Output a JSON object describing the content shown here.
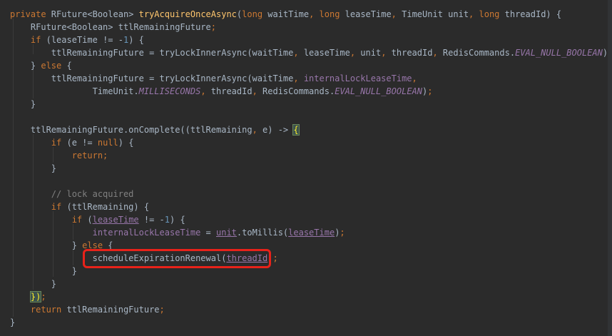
{
  "editor": {
    "lines": [
      [
        {
          "t": "private ",
          "c": "kw"
        },
        {
          "t": "RFuture<Boolean> "
        },
        {
          "t": "tryAcquireOnceAsync",
          "c": "fn"
        },
        {
          "t": "("
        },
        {
          "t": "long ",
          "c": "kw"
        },
        {
          "t": "waitTime"
        },
        {
          "t": ", ",
          "c": "kw"
        },
        {
          "t": "long ",
          "c": "kw"
        },
        {
          "t": "leaseTime"
        },
        {
          "t": ", ",
          "c": "kw"
        },
        {
          "t": "TimeUnit unit"
        },
        {
          "t": ", ",
          "c": "kw"
        },
        {
          "t": "long ",
          "c": "kw"
        },
        {
          "t": "threadId) {"
        }
      ],
      [
        {
          "t": "    RFuture<Boolean> ttlRemainingFuture"
        },
        {
          "t": ";",
          "c": "kw"
        }
      ],
      [
        {
          "t": "    "
        },
        {
          "t": "if ",
          "c": "kw"
        },
        {
          "t": "(leaseTime != -"
        },
        {
          "t": "1",
          "c": "num"
        },
        {
          "t": ") {"
        }
      ],
      [
        {
          "t": "        ttlRemainingFuture = tryLockInnerAsync(waitTime"
        },
        {
          "t": ", ",
          "c": "kw"
        },
        {
          "t": "leaseTime"
        },
        {
          "t": ", ",
          "c": "kw"
        },
        {
          "t": "unit"
        },
        {
          "t": ", ",
          "c": "kw"
        },
        {
          "t": "threadId"
        },
        {
          "t": ", ",
          "c": "kw"
        },
        {
          "t": "RedisCommands."
        },
        {
          "t": "EVAL_NULL_BOOLEAN",
          "c": "ital"
        },
        {
          "t": ")"
        },
        {
          "t": ";",
          "c": "kw"
        }
      ],
      [
        {
          "t": "    } "
        },
        {
          "t": "else ",
          "c": "kw"
        },
        {
          "t": "{"
        }
      ],
      [
        {
          "t": "        ttlRemainingFuture = tryLockInnerAsync(waitTime"
        },
        {
          "t": ", ",
          "c": "kw"
        },
        {
          "t": "internalLockLeaseTime",
          "c": "field"
        },
        {
          "t": ",",
          "c": "kw"
        }
      ],
      [
        {
          "t": "                TimeUnit."
        },
        {
          "t": "MILLISECONDS",
          "c": "ital"
        },
        {
          "t": ", ",
          "c": "kw"
        },
        {
          "t": "threadId"
        },
        {
          "t": ", ",
          "c": "kw"
        },
        {
          "t": "RedisCommands."
        },
        {
          "t": "EVAL_NULL_BOOLEAN",
          "c": "ital"
        },
        {
          "t": ")"
        },
        {
          "t": ";",
          "c": "kw"
        }
      ],
      [
        {
          "t": "    }"
        }
      ],
      [],
      [
        {
          "t": "    ttlRemainingFuture.onComplete((ttlRemaining"
        },
        {
          "t": ", ",
          "c": "kw"
        },
        {
          "t": "e) -> "
        },
        {
          "t": "{",
          "c": "brace-hl"
        }
      ],
      [
        {
          "t": "        "
        },
        {
          "t": "if ",
          "c": "kw"
        },
        {
          "t": "(e != "
        },
        {
          "t": "null",
          "c": "kw"
        },
        {
          "t": ") {"
        }
      ],
      [
        {
          "t": "            "
        },
        {
          "t": "return;",
          "c": "kw"
        }
      ],
      [
        {
          "t": "        }"
        }
      ],
      [],
      [
        {
          "t": "        "
        },
        {
          "t": "// lock acquired",
          "c": "comment"
        }
      ],
      [
        {
          "t": "        "
        },
        {
          "t": "if ",
          "c": "kw"
        },
        {
          "t": "(ttlRemaining) {"
        }
      ],
      [
        {
          "t": "            "
        },
        {
          "t": "if ",
          "c": "kw"
        },
        {
          "t": "("
        },
        {
          "t": "leaseTime",
          "c": "field ul"
        },
        {
          "t": " != -"
        },
        {
          "t": "1",
          "c": "num"
        },
        {
          "t": ") {"
        }
      ],
      [
        {
          "t": "                "
        },
        {
          "t": "internalLockLeaseTime",
          "c": "field"
        },
        {
          "t": " = "
        },
        {
          "t": "unit",
          "c": "field ul"
        },
        {
          "t": ".toMillis("
        },
        {
          "t": "leaseTime",
          "c": "field ul"
        },
        {
          "t": ")"
        },
        {
          "t": ";",
          "c": "kw"
        }
      ],
      [
        {
          "t": "            } "
        },
        {
          "t": "else ",
          "c": "kw"
        },
        {
          "t": "{"
        }
      ],
      [
        {
          "t": "                scheduleExpirationRenewal("
        },
        {
          "t": "threadId",
          "c": "field ul"
        },
        {
          "t": ")"
        },
        {
          "t": ";",
          "c": "kw"
        }
      ],
      [
        {
          "t": "            }"
        }
      ],
      [
        {
          "t": "        }"
        }
      ],
      [
        {
          "t": "    "
        },
        {
          "t": "})",
          "c": "brace-hl"
        },
        {
          "t": ";",
          "c": "kw"
        }
      ],
      [
        {
          "t": "    "
        },
        {
          "t": "return ",
          "c": "kw"
        },
        {
          "t": "ttlRemainingFuture"
        },
        {
          "t": ";",
          "c": "kw"
        }
      ],
      [
        {
          "t": "}"
        }
      ]
    ]
  },
  "colors": {
    "background": "#2b2b2b",
    "keyword": "#cc7832",
    "function": "#ffc66d",
    "number": "#6897bb",
    "comment": "#808080",
    "field": "#9876aa",
    "text": "#a9b7c6",
    "annotation_box": "#e8221a"
  }
}
